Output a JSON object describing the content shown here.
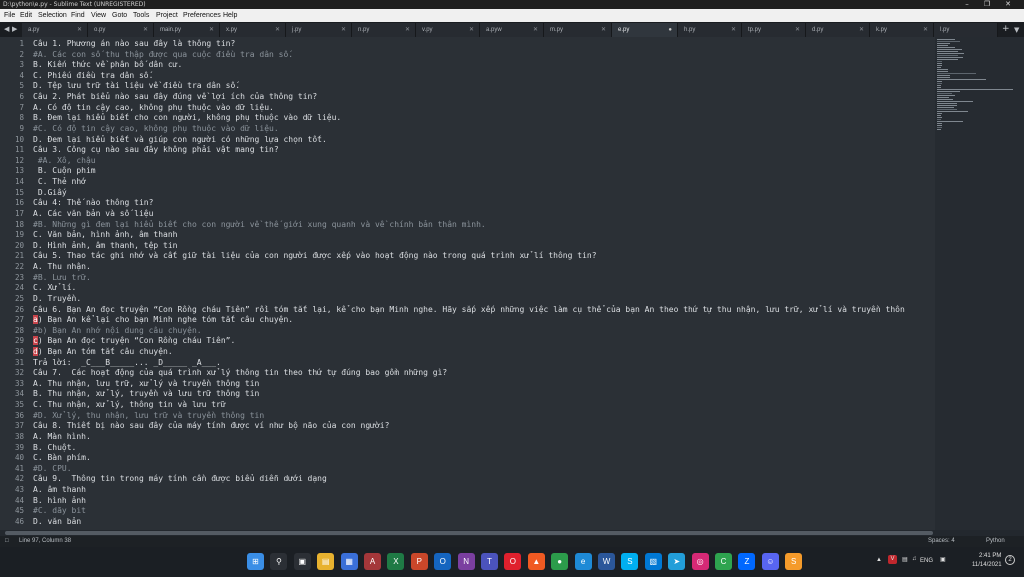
{
  "window": {
    "title": "D:\\python\\e.py - Sublime Text (UNREGISTERED)",
    "minimize_icon": "minimize-icon",
    "maximize_icon": "restore-icon",
    "close_icon": "close-icon"
  },
  "menu": [
    "File",
    "Edit",
    "Selection",
    "Find",
    "View",
    "Goto",
    "Tools",
    "Project",
    "Preferences",
    "Help"
  ],
  "tabs": [
    {
      "name": "a.py",
      "active": false
    },
    {
      "name": "o.py",
      "active": false
    },
    {
      "name": "main.py",
      "active": false
    },
    {
      "name": "x.py",
      "active": false
    },
    {
      "name": "j.py",
      "active": false
    },
    {
      "name": "n.py",
      "active": false
    },
    {
      "name": "v.py",
      "active": false
    },
    {
      "name": "a.pyw",
      "active": false
    },
    {
      "name": "m.py",
      "active": false
    },
    {
      "name": "e.py",
      "active": true
    },
    {
      "name": "h.py",
      "active": false
    },
    {
      "name": "tp.py",
      "active": false
    },
    {
      "name": "d.py",
      "active": false
    },
    {
      "name": "k.py",
      "active": false
    },
    {
      "name": "l.py",
      "active": false
    }
  ],
  "code_lines": [
    {
      "n": "1",
      "text": "Câu 1. Phương án nào sau đây là thông tin?",
      "comment": false
    },
    {
      "n": "2",
      "text": "#A. Các con số thu thập được qua cuộc điều tra dân số.",
      "comment": true
    },
    {
      "n": "3",
      "text": "B. Kiến thức về phân bố dân cư.",
      "comment": false
    },
    {
      "n": "4",
      "text": "C. Phiếu điều tra dân số.",
      "comment": false
    },
    {
      "n": "5",
      "text": "D. Tệp lưu trữ tài liệu về điều tra dân số.",
      "comment": false
    },
    {
      "n": "6",
      "text": "Câu 2. Phát biểu nào sau đây đúng về lợi ích của thông tin?",
      "comment": false
    },
    {
      "n": "7",
      "text": "A. Có độ tin cậy cao, không phụ thuộc vào dữ liệu.",
      "comment": false
    },
    {
      "n": "8",
      "text": "B. Đem lại hiểu biết cho con người, không phụ thuộc vào dữ liệu.",
      "comment": false
    },
    {
      "n": "9",
      "text": "#C. Có độ tin cậy cao, không phụ thuộc vào dữ liệu.",
      "comment": true
    },
    {
      "n": "10",
      "text": "D. Đem lại hiểu biết và giúp con người có những lựa chọn tốt.",
      "comment": false
    },
    {
      "n": "11",
      "text": "Câu 3. Công cụ nào sau đây không phải vật mang tin?",
      "comment": false
    },
    {
      "n": "12",
      "text": " #A. Xô, chậu",
      "comment": true
    },
    {
      "n": "13",
      "text": " B. Cuộn phim",
      "comment": false
    },
    {
      "n": "14",
      "text": " C. Thẻ nhớ",
      "comment": false
    },
    {
      "n": "15",
      "text": " D.Giấy",
      "comment": false
    },
    {
      "n": "16",
      "text": "Câu 4: Thế nào thông tin?",
      "comment": false
    },
    {
      "n": "17",
      "text": "A. Các văn bản và số liệu",
      "comment": false
    },
    {
      "n": "18",
      "text": "#B. Những gì đem lại hiểu biết cho con người về thế giới xung quanh và về chính bản thân mình.",
      "comment": true
    },
    {
      "n": "19",
      "text": "C. Văn bản, hình ảnh, âm thanh",
      "comment": false
    },
    {
      "n": "20",
      "text": "D. Hình ảnh, âm thanh, tệp tin",
      "comment": false
    },
    {
      "n": "21",
      "text": "Câu 5. Thao tác ghi nhớ và cất giữ tài liệu của con người được xếp vào hoạt động nào trong quá trình xử lí thông tin?",
      "comment": false
    },
    {
      "n": "22",
      "text": "A. Thu nhận.",
      "comment": false
    },
    {
      "n": "23",
      "text": "#B. Lưu trữ.",
      "comment": true
    },
    {
      "n": "24",
      "text": "C. Xử lí.",
      "comment": false
    },
    {
      "n": "25",
      "text": "D. Truyền.",
      "comment": false
    },
    {
      "n": "26",
      "text": "Câu 6. Bạn An đọc truyện “Con Rồng cháu Tiên” rồi tóm tắt lại, kể cho bạn Minh nghe. Hãy sắp xếp những việc làm cụ thể của bạn An theo thứ tự thu nhận, lưu trữ, xử lí và truyền thôn",
      "comment": false
    },
    {
      "n": "27",
      "text": "a) Bạn An kể lại cho bạn Minh nghe tóm tắt câu chuyện.",
      "comment": false,
      "hl": true
    },
    {
      "n": "28",
      "text": "#b) Bạn An nhớ nội dung câu chuyện.",
      "comment": true
    },
    {
      "n": "29",
      "text": "c) Bạn An đọc truyện “Con Rồng cháu Tiên”.",
      "comment": false,
      "hl": true
    },
    {
      "n": "30",
      "text": "d) Bạn An tóm tắt câu chuyện.",
      "comment": false,
      "hl": true
    },
    {
      "n": "31",
      "text": "Trả lời:  _C___B_____... _D_____ _A___.",
      "comment": false
    },
    {
      "n": "32",
      "text": "Câu 7.  Các hoạt động của quá trình xử lý thông tin theo thứ tự đúng bao gồm những gì?",
      "comment": false
    },
    {
      "n": "33",
      "text": "A. Thu nhận, lưu trữ, xử lý và truyền thông tin",
      "comment": false
    },
    {
      "n": "34",
      "text": "B. Thu nhận, xử lý, truyền và lưu trữ thông tin",
      "comment": false
    },
    {
      "n": "35",
      "text": "C. Thu nhận, xử lý, thông tin và lưu trữ",
      "comment": false
    },
    {
      "n": "36",
      "text": "#D. Xử lý, thu nhận, lưu trữ và truyền thông tin",
      "comment": true
    },
    {
      "n": "37",
      "text": "Câu 8. Thiết bị nào sau đây của máy tính được ví như bộ não của con người?",
      "comment": false
    },
    {
      "n": "38",
      "text": "A. Màn hình.",
      "comment": false
    },
    {
      "n": "39",
      "text": "B. Chuột.",
      "comment": false
    },
    {
      "n": "40",
      "text": "C. Bàn phím.",
      "comment": false
    },
    {
      "n": "41",
      "text": "#D. CPU.",
      "comment": true
    },
    {
      "n": "42",
      "text": "Câu 9.  Thông tin trong máy tính cần được biểu diễn dưới dạng",
      "comment": false
    },
    {
      "n": "43",
      "text": "A. âm thanh",
      "comment": false
    },
    {
      "n": "44",
      "text": "B. hình ảnh",
      "comment": false
    },
    {
      "n": "45",
      "text": "#C. dãy bit",
      "comment": true
    },
    {
      "n": "46",
      "text": "D. văn bản",
      "comment": false
    }
  ],
  "status": {
    "position": "Line 97, Column 38",
    "spaces": "Spaces: 4",
    "syntax": "Python"
  },
  "taskbar": {
    "icons": [
      "windows-start-icon",
      "search-icon",
      "task-view-icon",
      "file-explorer-icon",
      "microsoft-store-icon",
      "access-icon",
      "excel-icon",
      "powerpoint-icon",
      "outlook-icon",
      "onenote-icon",
      "teams-icon",
      "opera-icon",
      "brave-icon",
      "chrome-icon",
      "edge-icon",
      "word-icon",
      "skype-icon",
      "photos-icon",
      "telegram-icon",
      "instagram-icon",
      "camtasia-icon",
      "zalo-icon",
      "discord-icon",
      "sublime-text-icon"
    ],
    "tray": {
      "language": "ENG",
      "time": "2:41 PM",
      "date": "11/14/2021",
      "notifications": "2"
    }
  }
}
